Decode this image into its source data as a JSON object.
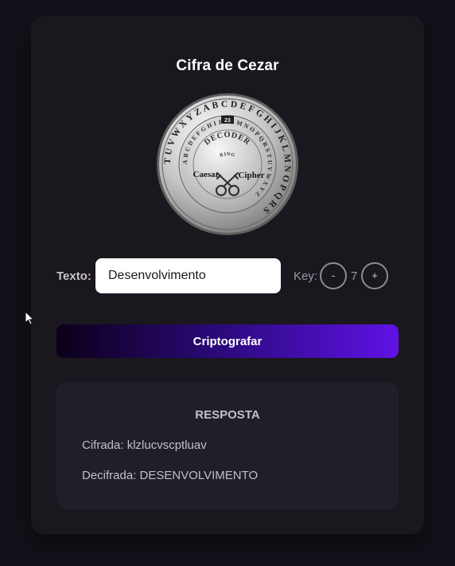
{
  "app": {
    "title": "Cifra de Cezar"
  },
  "coin": {
    "icon": "caesar-cipher-decoder-ring-icon",
    "outer_ring": "TUVWXYZABCDEFGHIJKLMNOPQRS",
    "inner_ring": "ABCDEFGHIJKLMNOPQRSTUVWXYZ",
    "center_top": "DECODER",
    "center_ring": "RING",
    "left_word": "Caesar",
    "right_word": "Cipher",
    "marker": "23"
  },
  "form": {
    "text_label": "Texto:",
    "text_value": "Desenvolvimento",
    "key_label": "Key:",
    "decrement_label": "-",
    "key_value": "7",
    "increment_label": "+",
    "submit_label": "Criptografar"
  },
  "result": {
    "title": "RESPOSTA",
    "encrypted_line": "Cifrada: klzlucvscptluav",
    "decrypted_line": "Decifrada: DESENVOLVIMENTO"
  },
  "colors": {
    "page_background": "#141019",
    "card_background": "#1b171f",
    "result_background": "#221e29",
    "accent_gradient_end": "#5f12e6"
  }
}
